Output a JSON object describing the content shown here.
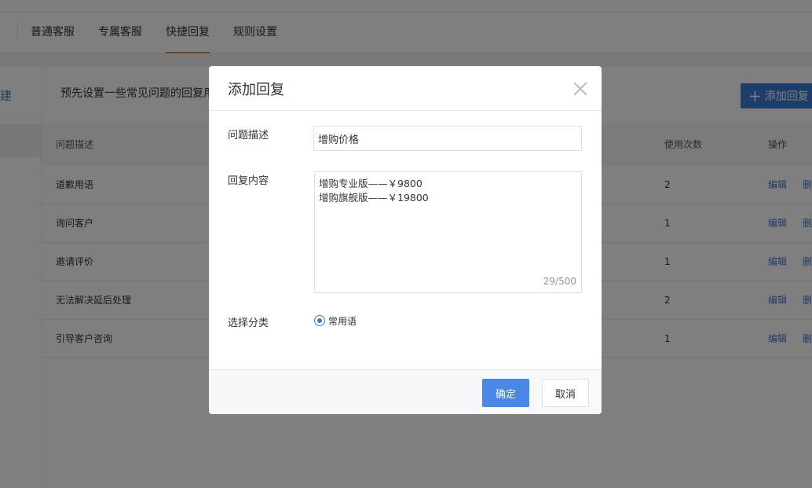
{
  "tabs": [
    "普通客服",
    "专属客服",
    "快捷回复",
    "规则设置"
  ],
  "sidebar": {
    "new_label": "建"
  },
  "main": {
    "description": "预先设置一些常见问题的回复用",
    "add_button_label": "添加回复",
    "columns": [
      "问题描述",
      "使用次数",
      "操作"
    ],
    "rows": [
      {
        "question": "道歉用语",
        "count": "2",
        "edit": "编辑",
        "delete": "删"
      },
      {
        "question": "询问客户",
        "count": "1",
        "edit": "编辑",
        "delete": "删"
      },
      {
        "question": "邀请评价",
        "count": "1",
        "edit": "编辑",
        "delete": "删"
      },
      {
        "question": "无法解决延后处理",
        "count": "2",
        "edit": "编辑",
        "delete": "删"
      },
      {
        "question": "引导客户咨询",
        "count": "1",
        "edit": "编辑",
        "delete": "删"
      }
    ]
  },
  "modal": {
    "title": "添加回复",
    "question_label": "问题描述",
    "question_value": "增购价格",
    "reply_label": "回复内容",
    "reply_value": "增购专业版——￥9800\n增购旗舰版——￥19800",
    "char_count": "29/500",
    "category_label": "选择分类",
    "category_option": "常用语",
    "confirm_label": "确定",
    "cancel_label": "取消"
  },
  "colors": {
    "accent": "#3a7bd5",
    "confirm": "#4a87e6",
    "active_tab": "#e0902e"
  }
}
